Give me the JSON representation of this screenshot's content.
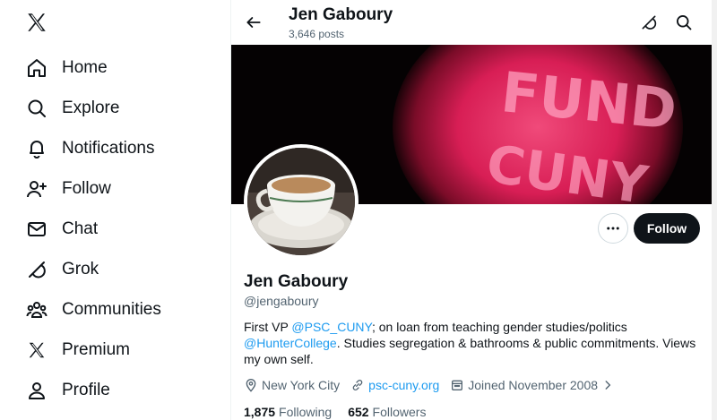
{
  "sidebar": {
    "logo_icon": "x-logo-icon",
    "items": [
      {
        "label": "Home",
        "icon": "home-icon"
      },
      {
        "label": "Explore",
        "icon": "search-icon"
      },
      {
        "label": "Notifications",
        "icon": "bell-icon"
      },
      {
        "label": "Follow",
        "icon": "person-plus-icon"
      },
      {
        "label": "Chat",
        "icon": "envelope-icon"
      },
      {
        "label": "Grok",
        "icon": "grok-icon"
      },
      {
        "label": "Communities",
        "icon": "people-icon"
      },
      {
        "label": "Premium",
        "icon": "x-logo-icon"
      },
      {
        "label": "Profile",
        "icon": "person-icon"
      }
    ]
  },
  "header": {
    "title": "Jen Gaboury",
    "posts": "3,646 posts"
  },
  "banner": {
    "text": "FUND CUNY",
    "glow_color": "#e8356a"
  },
  "profile": {
    "name": "Jen Gaboury",
    "handle": "@jengaboury",
    "follow_label": "Follow",
    "bio": {
      "part1": "First VP ",
      "mention1": "@PSC_CUNY",
      "part2": "; on loan from teaching gender studies/politics ",
      "mention2": "@HunterCollege",
      "part3": ". Studies segregation & bathrooms & public commitments. Views my own self."
    },
    "location": "New York City",
    "website": "psc-cuny.org",
    "joined": "Joined November 2008",
    "following_count": "1,875",
    "following_label": "Following",
    "followers_count": "652",
    "followers_label": "Followers"
  },
  "colors": {
    "text": "#0f1419",
    "secondary": "#536471",
    "link": "#1d9bf0",
    "button": "#0f1419"
  }
}
